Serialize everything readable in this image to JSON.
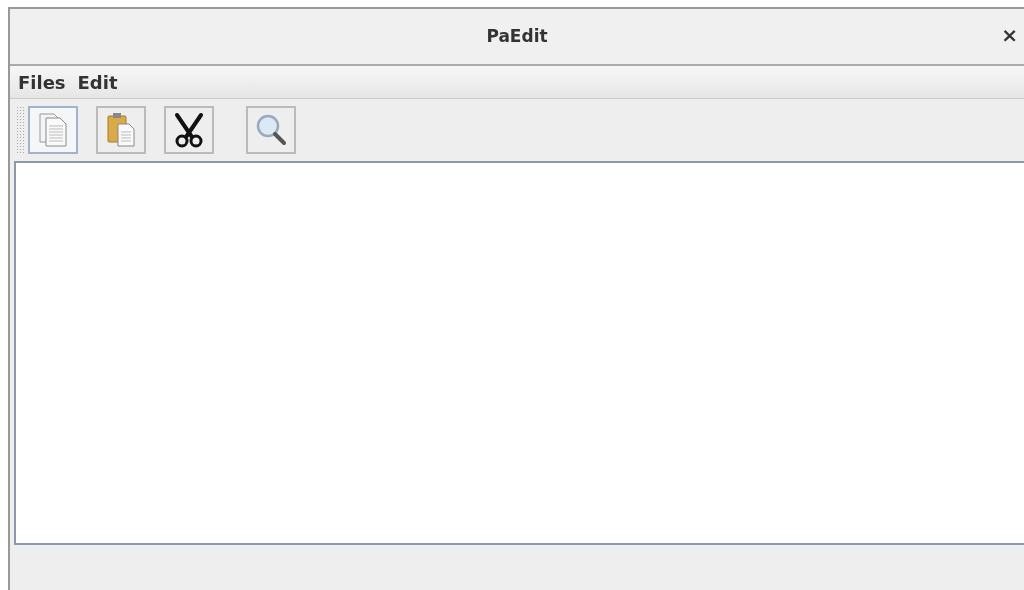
{
  "window": {
    "title": "PaEdit",
    "close": "×"
  },
  "menu": [
    "Files",
    "Edit"
  ],
  "toolbar": [
    {
      "kind": "copy",
      "selected": true
    },
    {
      "kind": "paste",
      "selected": false
    },
    {
      "kind": "cut",
      "selected": false
    },
    {
      "kind": "search",
      "selected": false
    }
  ]
}
